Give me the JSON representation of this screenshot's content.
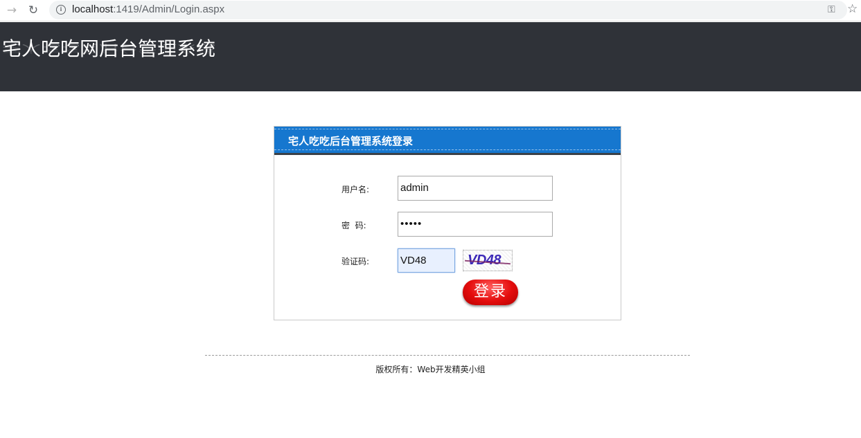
{
  "browser": {
    "back_icon": "arrow-right-icon",
    "reload_icon": "reload-icon",
    "info_icon": "info-icon",
    "url_host": "localhost",
    "url_path": ":1419/Admin/Login.aspx",
    "key_icon": "key-icon",
    "star_icon": "star-icon"
  },
  "header": {
    "site_title": "宅人吃吃网后台管理系统",
    "background_color": "#2f3238"
  },
  "login": {
    "title": "宅人吃吃后台管理系统登录",
    "header_color": "#1677cf",
    "username_label": "用户名:",
    "username_value": "admin",
    "password_label": "密  码:",
    "password_mask": "•••••",
    "captcha_label": "验证码:",
    "captcha_value": "VD48",
    "captcha_image_text": "VD48",
    "submit_label": "登录",
    "button_color": "#e40d0d"
  },
  "footer": {
    "copyright": "版权所有：Web开发精英小组"
  }
}
